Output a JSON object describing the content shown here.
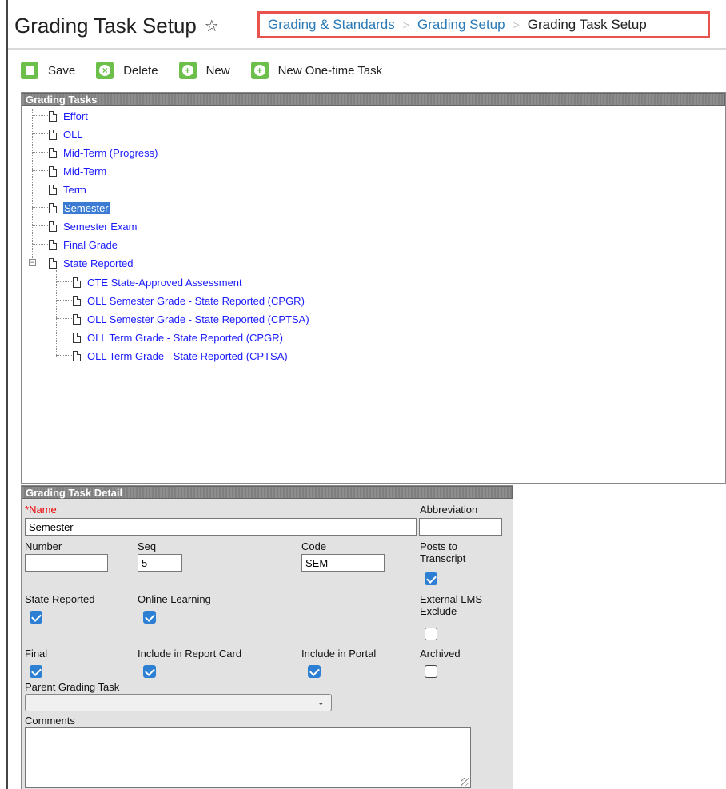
{
  "header": {
    "title": "Grading Task Setup",
    "breadcrumb": [
      "Grading & Standards",
      "Grading Setup",
      "Grading Task Setup"
    ]
  },
  "toolbar": {
    "save": "Save",
    "delete": "Delete",
    "new": "New",
    "new_one_time": "New One-time Task"
  },
  "tree": {
    "heading": "Grading Tasks",
    "items": [
      "Effort",
      "OLL",
      "Mid-Term (Progress)",
      "Mid-Term",
      "Term",
      "Semester",
      "Semester Exam",
      "Final Grade",
      "State Reported"
    ],
    "children": [
      "CTE State-Approved Assessment",
      "OLL Semester Grade - State Reported (CPGR)",
      "OLL Semester Grade - State Reported (CPTSA)",
      "OLL Term Grade - State Reported (CPGR)",
      "OLL Term Grade - State Reported (CPTSA)"
    ],
    "selected": "Semester"
  },
  "detail": {
    "heading": "Grading Task Detail",
    "name_req": "*",
    "name_label": "Name",
    "name_value": "Semester",
    "abbrev_label": "Abbreviation",
    "abbrev_value": "",
    "number_label": "Number",
    "number_value": "",
    "seq_label": "Seq",
    "seq_value": "5",
    "code_label": "Code",
    "code_value": "SEM",
    "posts_label_1": "Posts to",
    "posts_label_2": "Transcript",
    "posts_checked": true,
    "state_reported_label": "State Reported",
    "state_reported_checked": true,
    "online_learning_label": "Online Learning",
    "online_learning_checked": true,
    "external_lms_label_1": "External LMS",
    "external_lms_label_2": "Exclude",
    "external_lms_checked": false,
    "final_label": "Final",
    "final_checked": true,
    "report_card_label": "Include in Report Card",
    "report_card_checked": true,
    "portal_label": "Include in Portal",
    "portal_checked": true,
    "archived_label": "Archived",
    "archived_checked": false,
    "parent_label": "Parent Grading Task",
    "parent_value": "",
    "comments_label": "Comments"
  },
  "icons": {
    "save": "save-icon",
    "delete": "delete-icon",
    "new": "plus-icon",
    "star": "star-icon"
  },
  "colors": {
    "accent_green": "#6cbf4a",
    "link_blue": "#1a1aff",
    "highlight": "#e8534d",
    "checkbox": "#2d7fd3"
  }
}
